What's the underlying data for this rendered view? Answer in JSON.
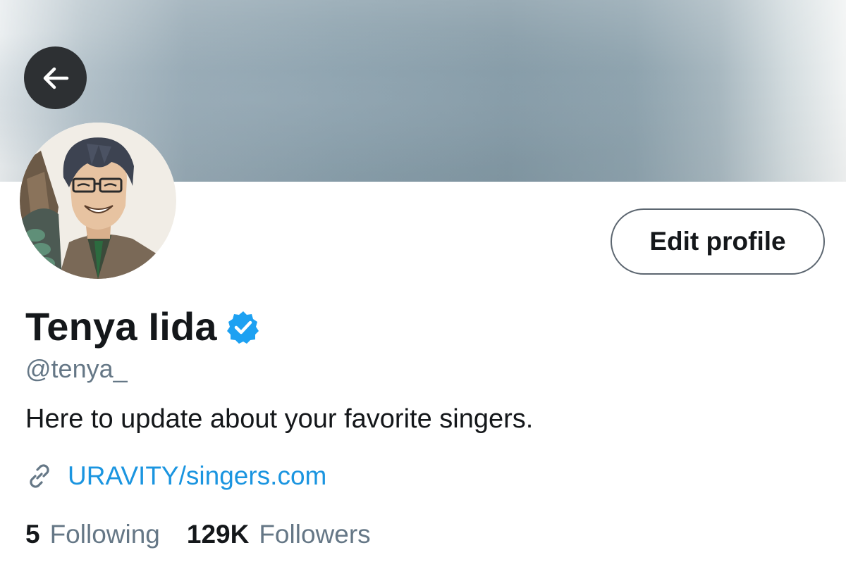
{
  "header": {
    "back_icon": "arrow-left-icon"
  },
  "profile": {
    "avatar_icon": "anime-character-avatar",
    "name": "Tenya Iida",
    "verified_icon": "verified-badge-icon",
    "handle": "@tenya_",
    "bio": "Here to update about your favorite singers.",
    "link_icon": "link-icon",
    "link": "URAVITY/singers.com",
    "edit_button_label": "Edit profile"
  },
  "stats": {
    "following_count": "5",
    "following_label": "Following",
    "followers_count": "129K",
    "followers_label": "Followers"
  },
  "colors": {
    "text_primary": "#14171a",
    "text_secondary": "#657786",
    "link": "#1b95e0",
    "verified": "#1da1f2",
    "back_button_bg": "#2d3033"
  }
}
